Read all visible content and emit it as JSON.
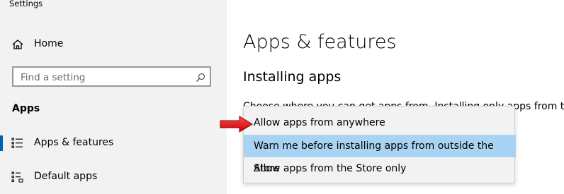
{
  "window": {
    "title": "Settings"
  },
  "sidebar": {
    "home_label": "Home",
    "search_placeholder": "Find a setting",
    "section_heading": "Apps",
    "items": [
      {
        "label": "Apps & features",
        "icon": "apps-features-icon",
        "active": true
      },
      {
        "label": "Default apps",
        "icon": "default-apps-icon",
        "active": false
      }
    ]
  },
  "main": {
    "title": "Apps & features",
    "subheading": "Installing apps",
    "description": "Choose where you can get apps from. Installing only apps from the"
  },
  "dropdown": {
    "options": [
      "Allow apps from anywhere",
      "Warn me before installing apps from outside the Store",
      "Allow apps from the Store only"
    ],
    "selected_index": 1
  },
  "colors": {
    "sidebar_bg": "#f2f2f2",
    "accent": "#0063b1",
    "selected_option_bg": "#a9d3f3",
    "annotation_arrow": "#e00000"
  }
}
